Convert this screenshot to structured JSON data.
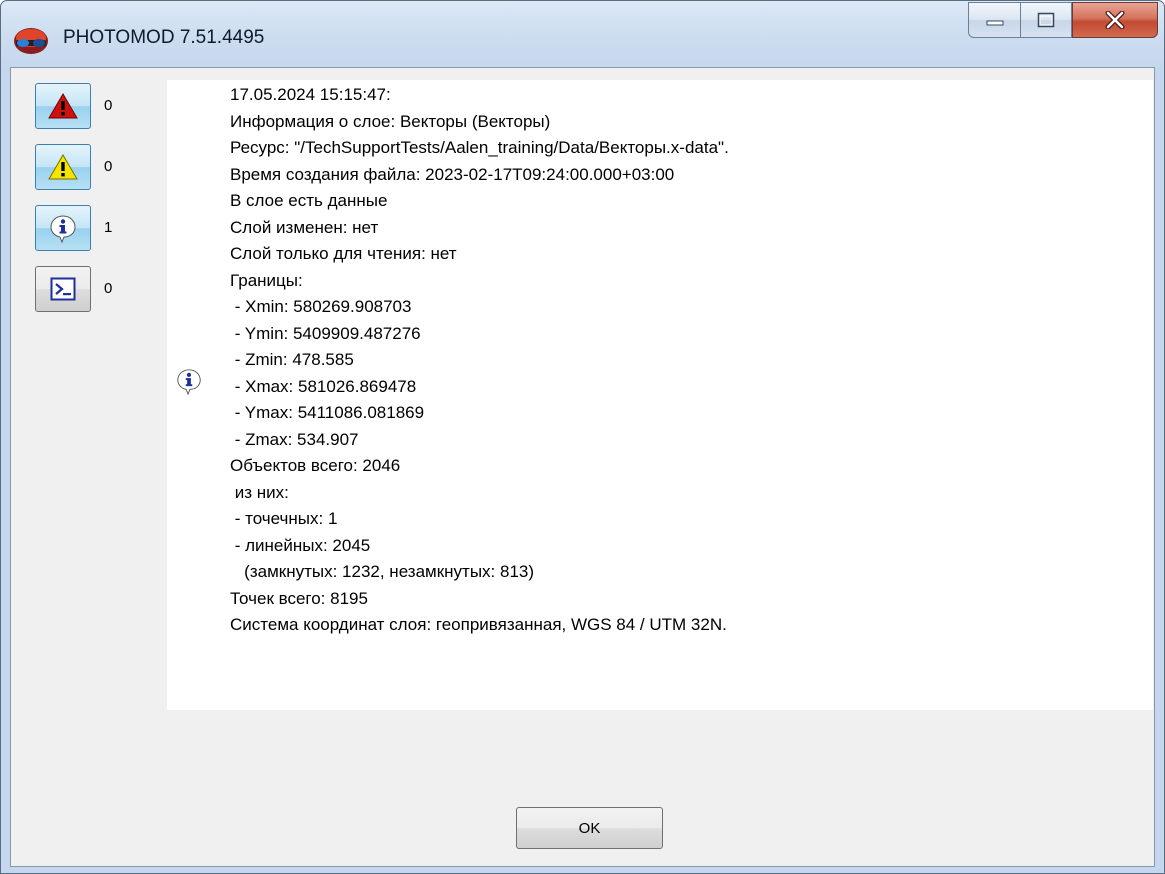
{
  "window": {
    "title": "PHOTOMOD 7.51.4495",
    "app_icon": "stereo-glasses-icon"
  },
  "caption_buttons": {
    "minimize_icon": "minimize-icon",
    "maximize_icon": "maximize-icon",
    "close_icon": "close-icon"
  },
  "message_filters": [
    {
      "icon": "error-icon",
      "count": "0",
      "color": "#cc1111"
    },
    {
      "icon": "warning-icon",
      "count": "0",
      "color": "#f4e400"
    },
    {
      "icon": "info-icon",
      "count": "1",
      "color": "#1c2f9c"
    },
    {
      "icon": "console-icon",
      "count": "0",
      "color": "#1c2f9c"
    }
  ],
  "log": {
    "entry_icon": "info-icon",
    "lines": [
      "17.05.2024 15:15:47:",
      "Информация о слое: Векторы (Векторы)",
      "Ресурс: \"/TechSupportTests/Aalen_training/Data/Векторы.x-data\".",
      "Время создания файла: 2023-02-17T09:24:00.000+03:00",
      "В слое есть данные",
      "Слой изменен: нет",
      "Слой только для чтения: нет",
      "Границы:",
      " - Xmin: 580269.908703",
      " - Ymin: 5409909.487276",
      " - Zmin: 478.585",
      " - Xmax: 581026.869478",
      " - Ymax: 5411086.081869",
      " - Zmax: 534.907",
      "Объектов всего: 2046",
      " из них:",
      " - точечных: 1",
      " - линейных: 2045",
      "   (замкнутых: 1232, незамкнутых: 813)",
      "Точек всего: 8195",
      "Система координат слоя: геопривязанная, WGS 84 / UTM 32N."
    ]
  },
  "ok_button": {
    "label": "OK"
  }
}
